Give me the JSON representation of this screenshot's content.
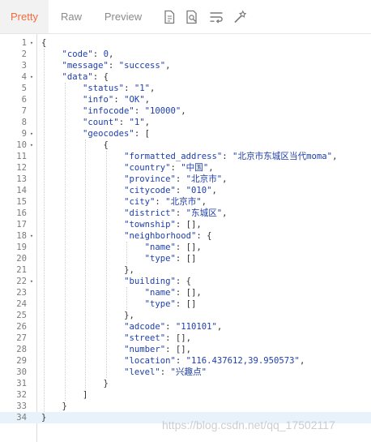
{
  "tabs": [
    {
      "label": "Pretty",
      "active": true
    },
    {
      "label": "Raw",
      "active": false
    },
    {
      "label": "Preview",
      "active": false
    }
  ],
  "toolbar_icons": [
    "document-icon",
    "search-document-icon",
    "wrap-lines-icon",
    "magic-wand-icon"
  ],
  "colors": {
    "accent": "#f26b3a",
    "key": "#1f3fa8",
    "current_line": "#e8f2fb"
  },
  "lines": [
    {
      "n": "1",
      "fold": true,
      "t": "{"
    },
    {
      "n": "2",
      "fold": false,
      "t": "    \"code\": 0,"
    },
    {
      "n": "3",
      "fold": false,
      "t": "    \"message\": \"success\","
    },
    {
      "n": "4",
      "fold": true,
      "t": "    \"data\": {"
    },
    {
      "n": "5",
      "fold": false,
      "t": "        \"status\": \"1\","
    },
    {
      "n": "6",
      "fold": false,
      "t": "        \"info\": \"OK\","
    },
    {
      "n": "7",
      "fold": false,
      "t": "        \"infocode\": \"10000\","
    },
    {
      "n": "8",
      "fold": false,
      "t": "        \"count\": \"1\","
    },
    {
      "n": "9",
      "fold": true,
      "t": "        \"geocodes\": ["
    },
    {
      "n": "10",
      "fold": true,
      "t": "            {"
    },
    {
      "n": "11",
      "fold": false,
      "t": "                \"formatted_address\": \"北京市东城区当代moma\","
    },
    {
      "n": "12",
      "fold": false,
      "t": "                \"country\": \"中国\","
    },
    {
      "n": "13",
      "fold": false,
      "t": "                \"province\": \"北京市\","
    },
    {
      "n": "14",
      "fold": false,
      "t": "                \"citycode\": \"010\","
    },
    {
      "n": "15",
      "fold": false,
      "t": "                \"city\": \"北京市\","
    },
    {
      "n": "16",
      "fold": false,
      "t": "                \"district\": \"东城区\","
    },
    {
      "n": "17",
      "fold": false,
      "t": "                \"township\": [],"
    },
    {
      "n": "18",
      "fold": true,
      "t": "                \"neighborhood\": {"
    },
    {
      "n": "19",
      "fold": false,
      "t": "                    \"name\": [],"
    },
    {
      "n": "20",
      "fold": false,
      "t": "                    \"type\": []"
    },
    {
      "n": "21",
      "fold": false,
      "t": "                },"
    },
    {
      "n": "22",
      "fold": true,
      "t": "                \"building\": {"
    },
    {
      "n": "23",
      "fold": false,
      "t": "                    \"name\": [],"
    },
    {
      "n": "24",
      "fold": false,
      "t": "                    \"type\": []"
    },
    {
      "n": "25",
      "fold": false,
      "t": "                },"
    },
    {
      "n": "26",
      "fold": false,
      "t": "                \"adcode\": \"110101\","
    },
    {
      "n": "27",
      "fold": false,
      "t": "                \"street\": [],"
    },
    {
      "n": "28",
      "fold": false,
      "t": "                \"number\": [],"
    },
    {
      "n": "29",
      "fold": false,
      "t": "                \"location\": \"116.437612,39.950573\","
    },
    {
      "n": "30",
      "fold": false,
      "t": "                \"level\": \"兴趣点\""
    },
    {
      "n": "31",
      "fold": false,
      "t": "            }"
    },
    {
      "n": "32",
      "fold": false,
      "t": "        ]"
    },
    {
      "n": "33",
      "fold": false,
      "t": "    }"
    },
    {
      "n": "34",
      "fold": false,
      "t": "}"
    }
  ],
  "current_line": "34",
  "watermark": "https://blog.csdn.net/qq_17502117"
}
